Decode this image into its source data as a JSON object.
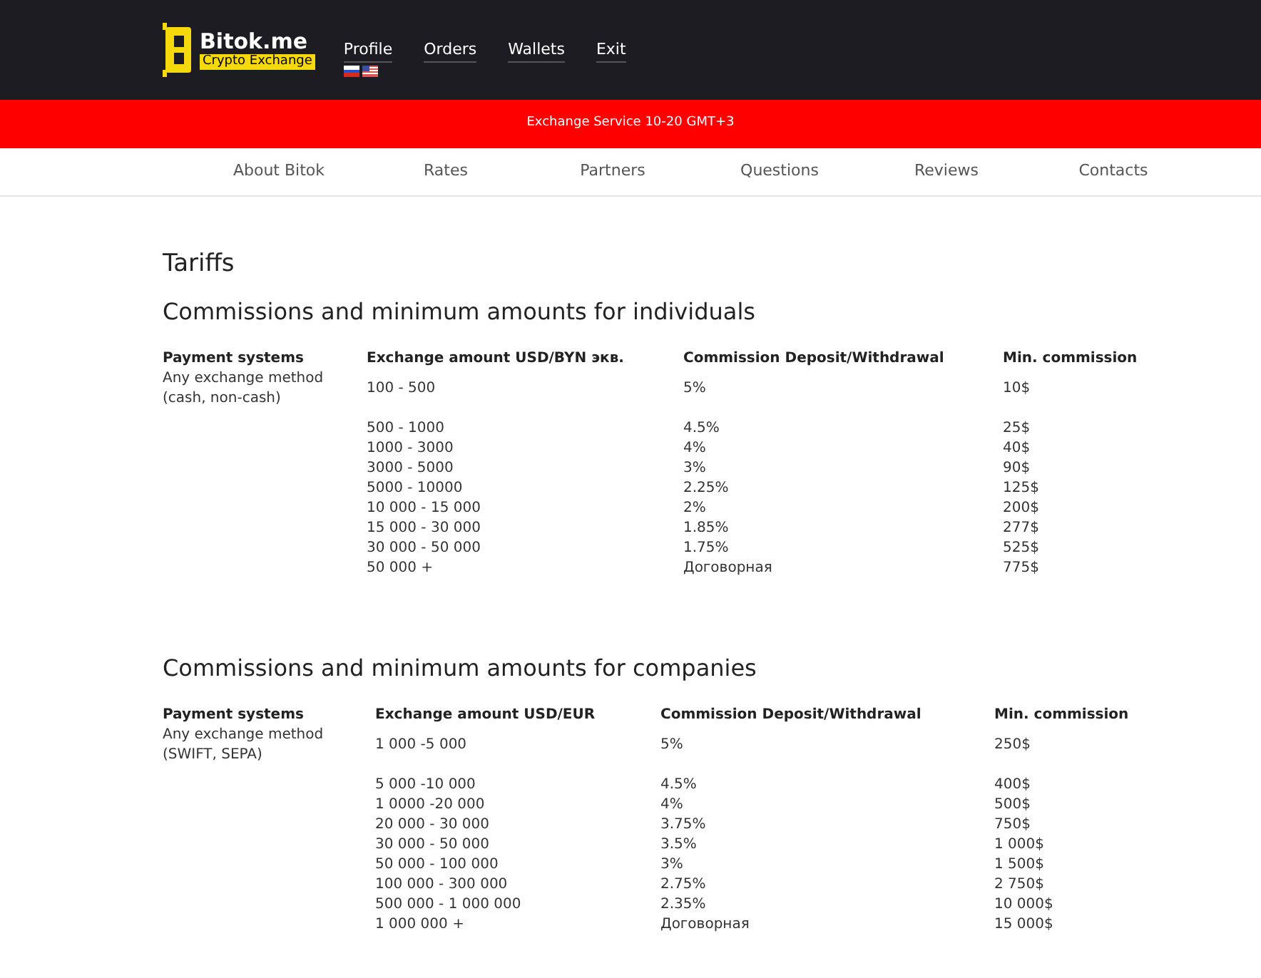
{
  "header": {
    "logo_name": "Bitok.me",
    "logo_tagline": "Crypto Exchange",
    "menu": [
      "Profile",
      "Orders",
      "Wallets",
      "Exit"
    ]
  },
  "banner": "Exchange Service 10-20 GMT+3",
  "nav": [
    "About Bitok",
    "Rates",
    "Partners",
    "Questions",
    "Reviews",
    "Contacts"
  ],
  "page_title": "Tariffs",
  "sections": [
    {
      "title": "Commissions and minimum amounts for individuals",
      "columns": [
        "Payment systems",
        "Exchange amount USD/BYN экв.",
        "Commission Deposit/Withdrawal",
        "Min. commission"
      ],
      "rows": [
        [
          "Any exchange method (cash, non-cash)",
          "100 - 500",
          "5%",
          "10$"
        ],
        [
          "",
          "500 - 1000",
          "4.5%",
          "25$"
        ],
        [
          "",
          "1000 - 3000",
          "4%",
          "40$"
        ],
        [
          "",
          "3000 - 5000",
          "3%",
          "90$"
        ],
        [
          "",
          "5000 - 10000",
          "2.25%",
          "125$"
        ],
        [
          "",
          "10 000 - 15 000",
          "2%",
          "200$"
        ],
        [
          "",
          "15 000 - 30 000",
          "1.85%",
          "277$"
        ],
        [
          "",
          "30 000 - 50 000",
          "1.75%",
          "525$"
        ],
        [
          "",
          "50 000 +",
          "Договорная",
          "775$"
        ]
      ]
    },
    {
      "title": "Commissions and minimum amounts for companies",
      "columns": [
        "Payment systems",
        "Exchange amount USD/EUR",
        "Commission Deposit/Withdrawal",
        "Min. commission"
      ],
      "rows": [
        [
          "Any exchange method (SWIFT, SEPA)",
          "1 000 -5 000",
          "5%",
          "250$"
        ],
        [
          "",
          "5 000 -10 000",
          "4.5%",
          "400$"
        ],
        [
          "",
          "1 0000 -20 000",
          "4%",
          "500$"
        ],
        [
          "",
          "20 000 - 30 000",
          "3.75%",
          "750$"
        ],
        [
          "",
          "30 000 - 50 000",
          "3.5%",
          "1 000$"
        ],
        [
          "",
          "50 000 - 100 000",
          "3%",
          "1 500$"
        ],
        [
          "",
          "100 000 - 300 000",
          "2.75%",
          "2 750$"
        ],
        [
          "",
          "500 000 - 1 000 000",
          "2.35%",
          "10 000$"
        ],
        [
          "",
          "1 000 000 +",
          "Договорная",
          "15 000$"
        ]
      ]
    }
  ]
}
